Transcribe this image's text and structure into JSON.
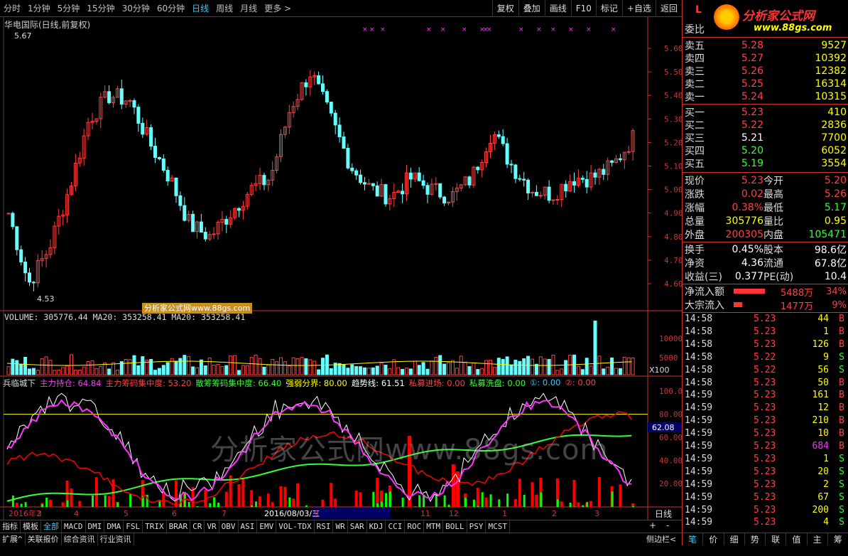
{
  "periods": [
    "分时",
    "1分钟",
    "5分钟",
    "15分钟",
    "30分钟",
    "60分钟",
    "日线",
    "周线",
    "月线",
    "更多 >"
  ],
  "active_period": "日线",
  "toolbar": [
    "复权",
    "叠加",
    "画线",
    "F10",
    "标记",
    "+自选",
    "返回"
  ],
  "stock_title": "华电国际(日线,前复权)",
  "price_axis": [
    "5.60",
    "5.50",
    "5.40",
    "5.30",
    "5.20",
    "5.10",
    "5.00",
    "4.90",
    "4.80",
    "4.70",
    "4.60"
  ],
  "high_mark": "5.67",
  "low_mark": "4.53",
  "watermark_small": "分析家公式网www.88gs.com",
  "watermark_big": "分析家公式网www.88gs.com",
  "volume_label": "VOLUME: 305776.44  MA20: 353258.41  MA20: 353258.41",
  "volume_axis": [
    "10000",
    "5000"
  ],
  "volume_unit": "X100",
  "indicator_labels": [
    {
      "text": "兵临城下",
      "color": "#ddd"
    },
    {
      "text": "主力持仓: 64.84",
      "color": "#f3f"
    },
    {
      "text": "主力筹码集中度: 53.20",
      "color": "#ff4040"
    },
    {
      "text": "散筹筹码集中度: 66.40",
      "color": "#3f3"
    },
    {
      "text": "强弱分界: 80.00",
      "color": "#ff0"
    },
    {
      "text": "趋势线: 61.51",
      "color": "#fff"
    },
    {
      "text": "私募进场: 0.00",
      "color": "#ff4040"
    },
    {
      "text": "私募洗盘: 0.00",
      "color": "#3f3"
    },
    {
      "text": "①: 0.00",
      "color": "#3cf"
    },
    {
      "text": "②: 0.00",
      "color": "#ff4040"
    }
  ],
  "ind_axis": [
    "100.0",
    "80.00",
    "60.00",
    "40.00",
    "20.00"
  ],
  "ind_value_badge": "62.08",
  "date_axis": [
    "2016年2",
    "3",
    "4",
    "5",
    "6",
    "7",
    "2016/08/03/三",
    "9",
    "11",
    "12",
    "1",
    "2",
    "3"
  ],
  "date_axis_unit": "日线",
  "tabs1": [
    "指标",
    "模板",
    "全部",
    "MACD",
    "DMI",
    "DMA",
    "FSL",
    "TRIX",
    "BRAR",
    "CR",
    "VR",
    "OBV",
    "ASI",
    "EMV",
    "VOL-TDX",
    "RSI",
    "WR",
    "SAR",
    "KDJ",
    "CCI",
    "ROC",
    "MTM",
    "BOLL",
    "PSY",
    "MCST"
  ],
  "tabs1_active": "全部",
  "tabs2": [
    "扩展^",
    "关联报价",
    "综合资讯",
    "行业资讯"
  ],
  "side_ctrl": [
    "+",
    "-",
    "侧边栏<"
  ],
  "logo_text": "分析家公式网",
  "logo_url": "www.88gs.com",
  "dash": {
    "header": "委比",
    "asks": [
      {
        "label": "卖五",
        "price": "5.28",
        "vol": "9527"
      },
      {
        "label": "卖四",
        "price": "5.27",
        "vol": "10392"
      },
      {
        "label": "卖三",
        "price": "5.26",
        "vol": "12382"
      },
      {
        "label": "卖二",
        "price": "5.25",
        "vol": "16314"
      },
      {
        "label": "卖一",
        "price": "5.24",
        "vol": "10315"
      }
    ],
    "bids": [
      {
        "label": "买一",
        "price": "5.23",
        "vol": "410"
      },
      {
        "label": "买二",
        "price": "5.22",
        "vol": "2836"
      },
      {
        "label": "买三",
        "price": "5.21",
        "vol": "7700"
      },
      {
        "label": "买四",
        "price": "5.20",
        "vol": "6052"
      },
      {
        "label": "买五",
        "price": "5.19",
        "vol": "3554"
      }
    ],
    "stats": [
      {
        "l1": "现价",
        "v1": "5.23",
        "l2": "今开",
        "v2": "5.20"
      },
      {
        "l1": "涨跌",
        "v1": "0.02",
        "l2": "最高",
        "v2": "5.26"
      },
      {
        "l1": "涨幅",
        "v1": "0.38%",
        "l2": "最低",
        "v2": "5.17"
      },
      {
        "l1": "总量",
        "v1": "305776",
        "l2": "量比",
        "v2": "0.95"
      },
      {
        "l1": "外盘",
        "v1": "200305",
        "l2": "内盘",
        "v2": "105471"
      }
    ],
    "stats2": [
      {
        "l1": "换手",
        "v1": "0.45%",
        "l2": "股本",
        "v2": "98.6亿"
      },
      {
        "l1": "净资",
        "v1": "4.36",
        "l2": "流通",
        "v2": "67.8亿"
      },
      {
        "l1": "收益(三)",
        "v1": "0.377",
        "l2": "PE(动)",
        "v2": "10.4"
      }
    ],
    "flows": [
      {
        "label": "净流入额",
        "val": "5488万",
        "pct": "34%"
      },
      {
        "label": "大宗流入",
        "val": "1477万",
        "pct": "9%"
      }
    ],
    "ticks": [
      {
        "t": "14:58",
        "p": "5.23",
        "v": "44",
        "s": "B"
      },
      {
        "t": "14:58",
        "p": "5.23",
        "v": "1",
        "s": "B"
      },
      {
        "t": "14:58",
        "p": "5.23",
        "v": "126",
        "s": "B"
      },
      {
        "t": "14:58",
        "p": "5.22",
        "v": "9",
        "s": "S"
      },
      {
        "t": "14:58",
        "p": "5.22",
        "v": "56",
        "s": "S"
      },
      {
        "t": "14:58",
        "p": "5.23",
        "v": "50",
        "s": "B"
      },
      {
        "t": "14:59",
        "p": "5.23",
        "v": "161",
        "s": "B"
      },
      {
        "t": "14:59",
        "p": "5.23",
        "v": "12",
        "s": "B"
      },
      {
        "t": "14:59",
        "p": "5.23",
        "v": "210",
        "s": "B"
      },
      {
        "t": "14:59",
        "p": "5.23",
        "v": "10",
        "s": "B"
      },
      {
        "t": "14:59",
        "p": "5.23",
        "v": "684",
        "s": "B"
      },
      {
        "t": "14:59",
        "p": "5.23",
        "v": "1",
        "s": "S"
      },
      {
        "t": "14:59",
        "p": "5.23",
        "v": "20",
        "s": "S"
      },
      {
        "t": "14:59",
        "p": "5.23",
        "v": "2",
        "s": "S"
      },
      {
        "t": "14:59",
        "p": "5.23",
        "v": "67",
        "s": "S"
      },
      {
        "t": "14:59",
        "p": "5.23",
        "v": "200",
        "s": "S"
      },
      {
        "t": "14:59",
        "p": "5.23",
        "v": "4",
        "s": "S"
      }
    ],
    "tabs": [
      "笔",
      "价",
      "细",
      "势",
      "联",
      "值",
      "主",
      "筹"
    ],
    "active_tab": "笔"
  },
  "colors": {
    "up": "#ff4040",
    "down": "#6ff",
    "ma": "#ff0",
    "panel_border": "#c33"
  }
}
